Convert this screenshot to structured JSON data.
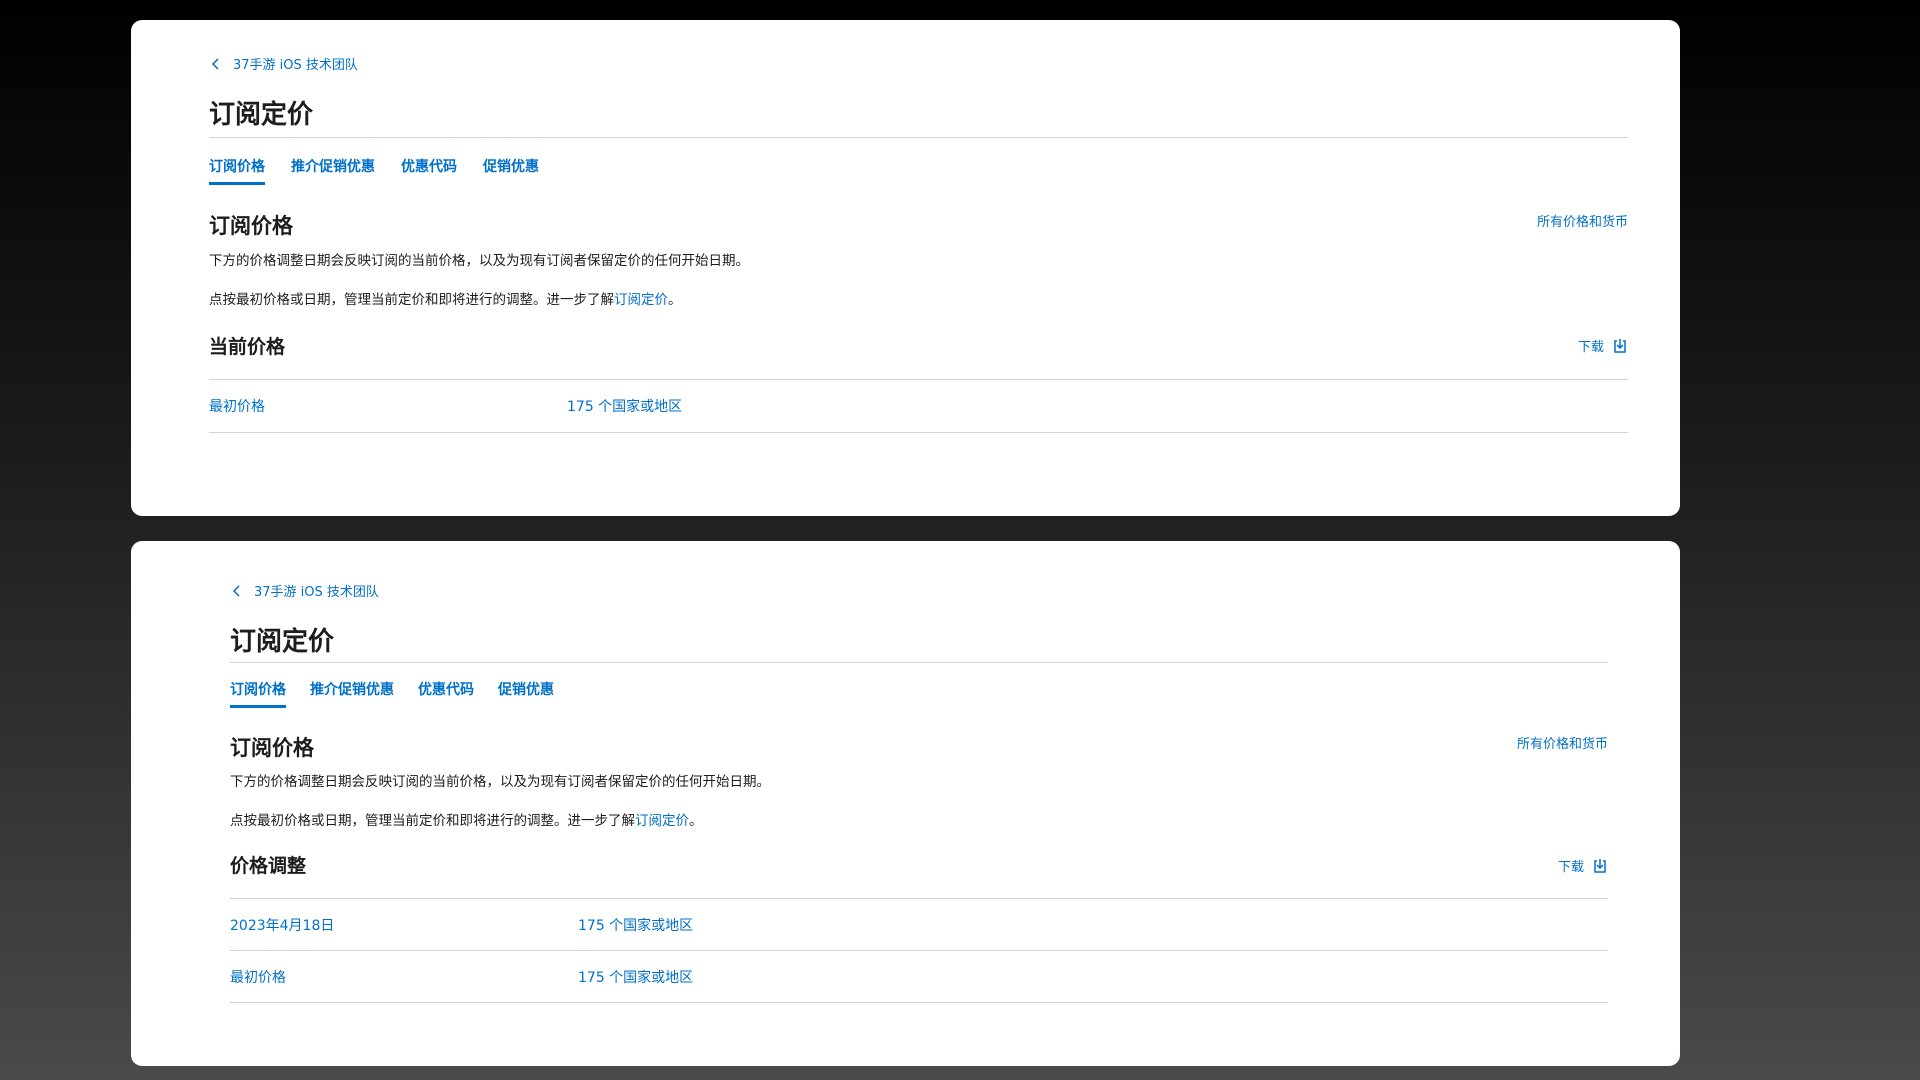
{
  "panels": [
    {
      "breadcrumb": "37手游 iOS 技术团队",
      "page_title": "订阅定价",
      "tabs": [
        "订阅价格",
        "推介促销优惠",
        "优惠代码",
        "促销优惠"
      ],
      "section_title": "订阅价格",
      "all_prices_link": "所有价格和货币",
      "desc_1": "下方的价格调整日期会反映订阅的当前价格，以及为现有订阅者保留定价的任何开始日期。",
      "desc_2_prefix": "点按最初价格或日期，管理当前定价和即将进行的调整。进一步了解",
      "desc_2_link": "订阅定价",
      "desc_2_suffix": "。",
      "sub_title": "当前价格",
      "download_label": "下载",
      "rows": [
        {
          "label": "最初价格",
          "regions": "175 个国家或地区"
        }
      ]
    },
    {
      "breadcrumb": "37手游 iOS 技术团队",
      "page_title": "订阅定价",
      "tabs": [
        "订阅价格",
        "推介促销优惠",
        "优惠代码",
        "促销优惠"
      ],
      "section_title": "订阅价格",
      "all_prices_link": "所有价格和货币",
      "desc_1": "下方的价格调整日期会反映订阅的当前价格，以及为现有订阅者保留定价的任何开始日期。",
      "desc_2_prefix": "点按最初价格或日期，管理当前定价和即将进行的调整。进一步了解",
      "desc_2_link": "订阅定价",
      "desc_2_suffix": "。",
      "sub_title": "价格调整",
      "download_label": "下载",
      "rows": [
        {
          "label": "2023年4月18日",
          "regions": "175 个国家或地区"
        },
        {
          "label": "最初价格",
          "regions": "175 个国家或地区"
        }
      ]
    }
  ],
  "colors": {
    "accent": "#0070c9",
    "text": "#1d1d1f",
    "rule": "#d2d2d7"
  }
}
